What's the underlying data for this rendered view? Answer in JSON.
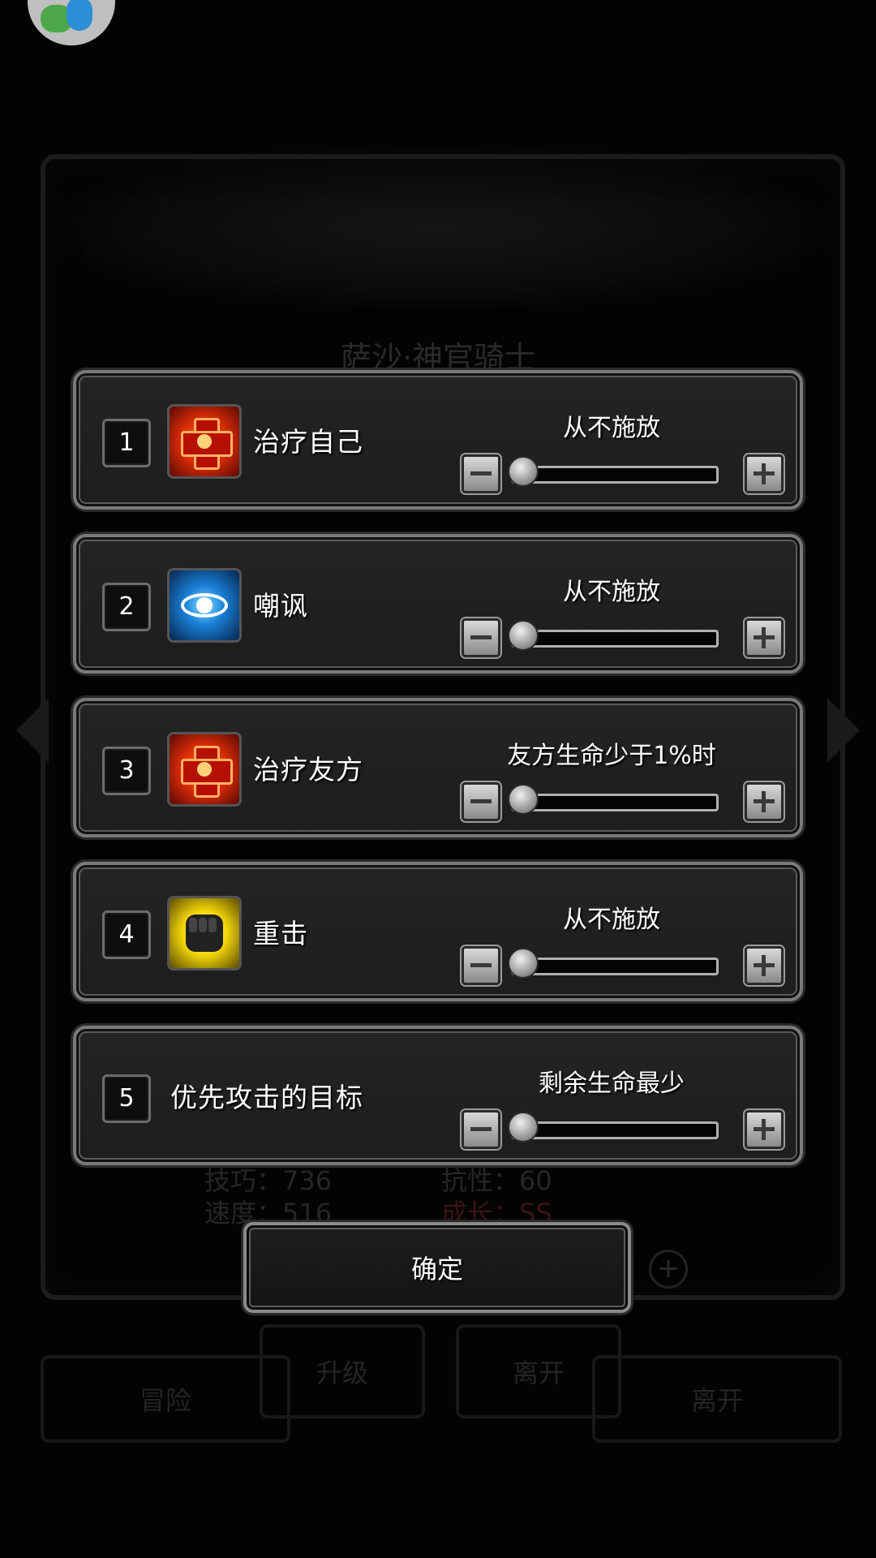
{
  "background": {
    "title": "萨沙·神官骑士",
    "stats": [
      {
        "label": "技巧：736"
      },
      {
        "label": "抗性：60"
      },
      {
        "label": "速度：516"
      },
      {
        "label": "成长：SS"
      }
    ],
    "buttons": {
      "adventure": "冒险",
      "upgrade": "升级",
      "leave_small": "离开",
      "leave_big": "离开"
    }
  },
  "skills": [
    {
      "index": "1",
      "name": "治疗自己",
      "status": "从不施放",
      "level": 0,
      "icon": "heal-cross-icon"
    },
    {
      "index": "2",
      "name": "嘲讽",
      "status": "从不施放",
      "level": 0,
      "icon": "eye-icon"
    },
    {
      "index": "3",
      "name": "治疗友方",
      "status": "友方生命少于1%时",
      "level": 0,
      "icon": "heal-cross-icon"
    },
    {
      "index": "4",
      "name": "重击",
      "status": "从不施放",
      "level": 0,
      "icon": "fist-icon"
    },
    {
      "index": "5",
      "name": "优先攻击的目标",
      "status": "剩余生命最少",
      "level": 0,
      "icon": null
    }
  ],
  "confirm_label": "确定",
  "colors": {
    "panel_bg": "#212121",
    "panel_border": "#7a7a7a",
    "text": "#ffffff"
  }
}
